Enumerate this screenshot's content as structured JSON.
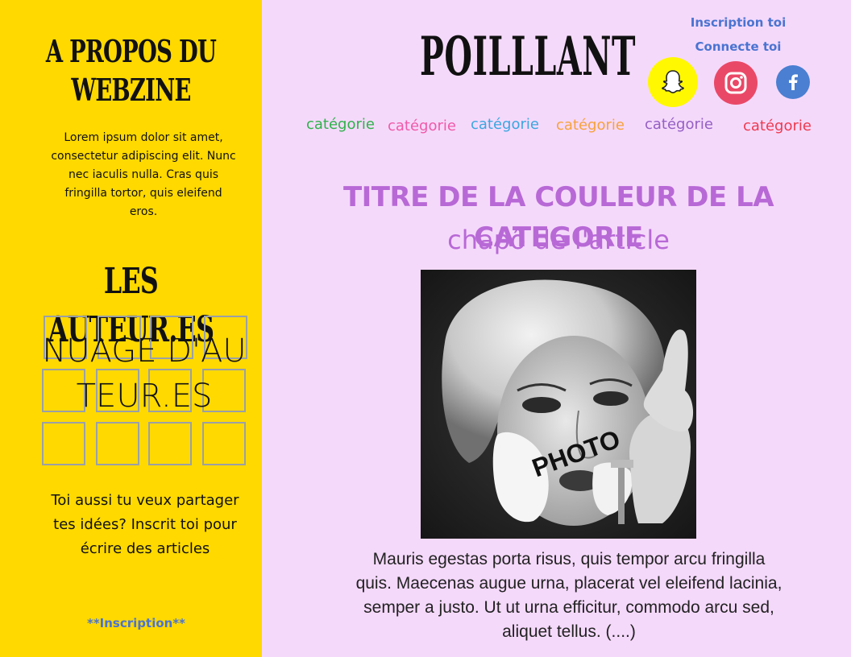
{
  "sidebar": {
    "about_title": "A PROPOS DU WEBZINE",
    "about_text": "Lorem ipsum dolor sit amet, consectetur adipiscing elit. Nunc nec iaculis nulla. Cras quis fringilla tortor, quis eleifend eros.",
    "authors_title": "LES AUTEUR.ES",
    "authors_cloud": "NUAGE D'AUTEUR.ES",
    "cta": "Toi aussi tu veux partager tes idées? Inscrit toi pour écrire des articles",
    "inscription_link": "**Inscription**"
  },
  "header": {
    "brand": "POILLLANT",
    "inscription_link": "Inscription toi",
    "connect_link": "Connecte toi",
    "social": [
      {
        "name": "snapchat-icon",
        "color": "#fff800"
      },
      {
        "name": "instagram-icon",
        "color": "#ea4867"
      },
      {
        "name": "facebook-icon",
        "color": "#4a7fd1"
      }
    ]
  },
  "categories": [
    {
      "label": "catégorie",
      "color": "#2fb24a"
    },
    {
      "label": "catégorie",
      "color": "#f05aa8"
    },
    {
      "label": "catégorie",
      "color": "#3aa7e0"
    },
    {
      "label": "catégorie",
      "color": "#f7a23c"
    },
    {
      "label": "catégorie",
      "color": "#9460c4"
    },
    {
      "label": "catégorie",
      "color": "#ee3a4f"
    }
  ],
  "article": {
    "title": "TITRE DE LA COULEUR DE LA CATEGORIE",
    "chapo": "chapô de l'article",
    "photo_label": "PHOTO",
    "body": "Mauris egestas porta risus, quis tempor arcu fringilla quis. Maecenas augue urna, placerat vel eleifend lacinia, semper a justo. Ut ut urna efficitur, commodo arcu sed, aliquet tellus. (....)",
    "title_color": "#b869d6"
  },
  "colors": {
    "sidebar_bg": "#ffd900",
    "page_bg": "#f5d9fb",
    "link_blue": "#4a74d1"
  }
}
